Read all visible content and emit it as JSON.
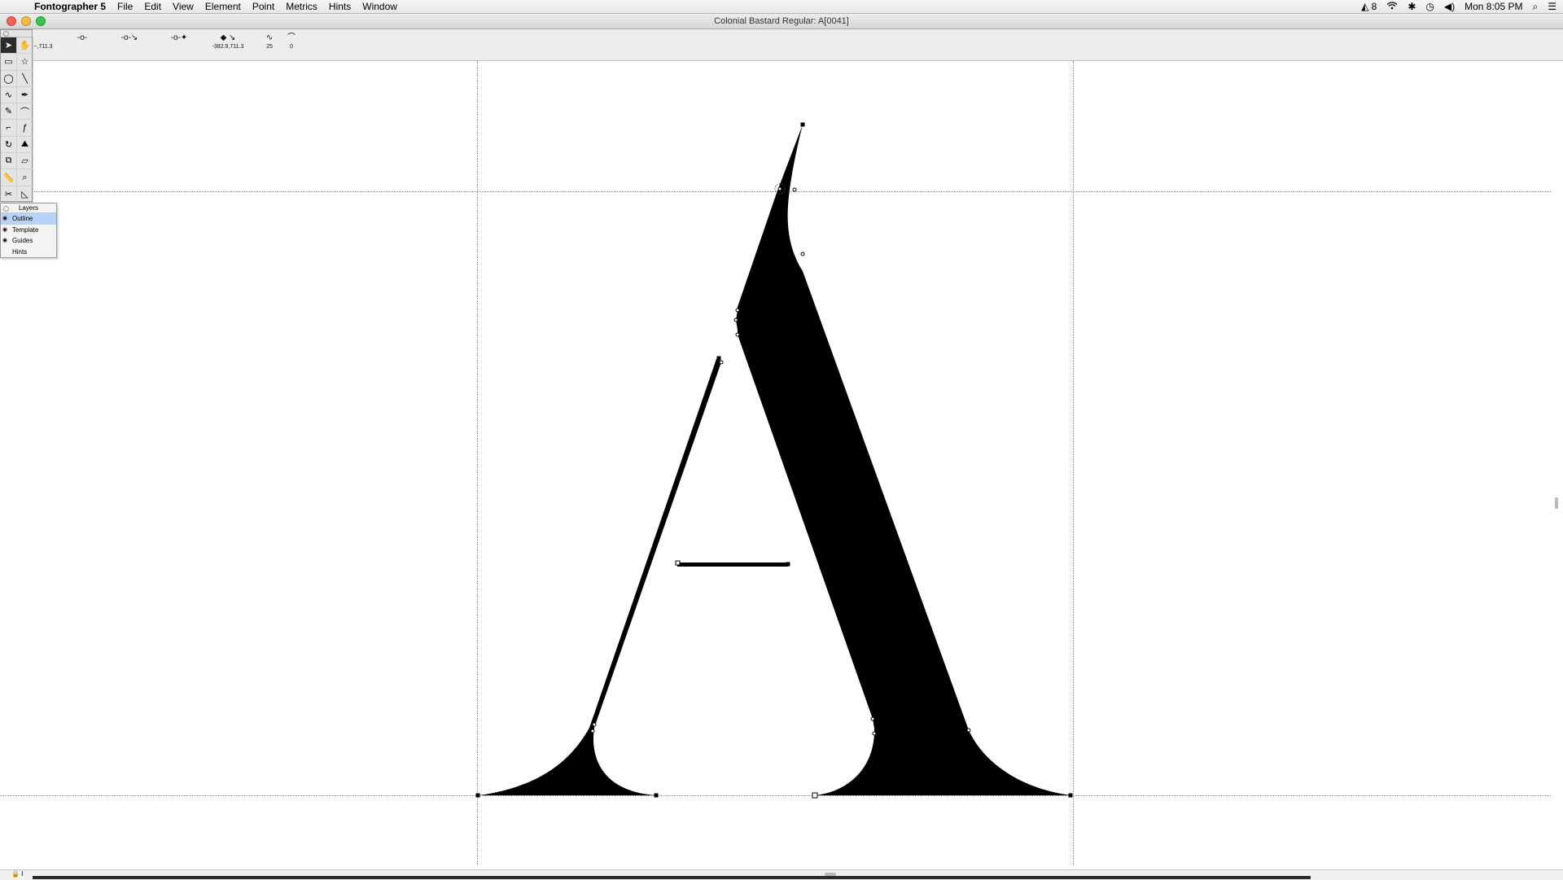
{
  "menubar": {
    "apple": "",
    "app_name": "Fontographer 5",
    "items": [
      "File",
      "Edit",
      "View",
      "Element",
      "Point",
      "Metrics",
      "Hints",
      "Window"
    ],
    "status": {
      "adobe_badge": "8",
      "clock": "Mon 8:05 PM"
    }
  },
  "window": {
    "title": "Colonial Bastard Regular: A[0041]"
  },
  "pointbar": {
    "coord1": "~,711.3",
    "coord2": "-382.9,711.3",
    "curve_value": "25",
    "tangent_value": "0"
  },
  "layers": {
    "title": "Layers",
    "items": [
      {
        "label": "Outline",
        "selected": true
      },
      {
        "label": "Template",
        "selected": false
      },
      {
        "label": "Guides",
        "selected": false
      },
      {
        "label": "Hints",
        "selected": false
      }
    ]
  },
  "tools": [
    "pointer-tool",
    "hand-tool",
    "rectangle-tool",
    "star-tool",
    "ellipse-tool",
    "line-tool",
    "freehand-tool",
    "pen-tool",
    "pencil-tool",
    "curve-tool",
    "corner-tool",
    "tangent-tool",
    "rotate-tool",
    "perspective-tool",
    "scale-tool",
    "skew-tool",
    "measure-tool",
    "zoom-tool",
    "knife-tool",
    "shape-tool"
  ],
  "colors": {
    "glyph": "#000000",
    "guide": "#8a8a8a",
    "selection": "#b7d3f5"
  }
}
